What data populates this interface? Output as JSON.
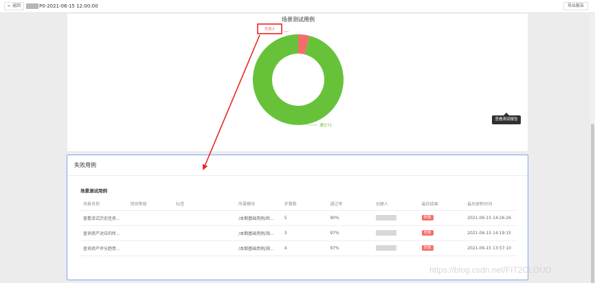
{
  "topbar": {
    "back_label": "返回",
    "report_title": "P0-2021-06-15 12:00:00",
    "export_label": "导出报告"
  },
  "chart_data": {
    "type": "pie",
    "title": "场景测试用例",
    "slices": [
      {
        "label": "失败",
        "value": 3,
        "display": "失败3",
        "color": "#f56c6c"
      },
      {
        "label": "通过",
        "value": 72,
        "display": "通过72",
        "color": "#67c23a"
      }
    ]
  },
  "tooltip": {
    "text": "查看测试报告"
  },
  "failed_cases": {
    "header": "失败用例",
    "section_title": "场景测试用例",
    "columns": [
      "场景名称",
      "用例等级",
      "标签",
      "所属模块",
      "步骤数",
      "通过率",
      "创建人",
      "最后结果",
      "最后更新时间"
    ],
    "rows": [
      {
        "name": "查看流式历史任务...",
        "level": "",
        "tags": "",
        "module": "/本期基础用例/检...",
        "steps": "5",
        "pass_rate": "90%",
        "result": "失败",
        "updated": "2021-06-15 14:26:26"
      },
      {
        "name": "查询资产对应的所...",
        "level": "",
        "tags": "",
        "module": "/本期基础用例/指...",
        "steps": "3",
        "pass_rate": "97%",
        "result": "失败",
        "updated": "2021-06-15 14:19:15"
      },
      {
        "name": "查询资产评分趋势...",
        "level": "",
        "tags": "",
        "module": "/本期基础用例/指...",
        "steps": "4",
        "pass_rate": "97%",
        "result": "失败",
        "updated": "2021-06-15 13:57:10"
      }
    ]
  },
  "colors": {
    "annotation_red": "#e8241e",
    "card_highlight": "#7aa7f2"
  },
  "watermark": "https://blog.csdn.net/FIT2CLOUD"
}
